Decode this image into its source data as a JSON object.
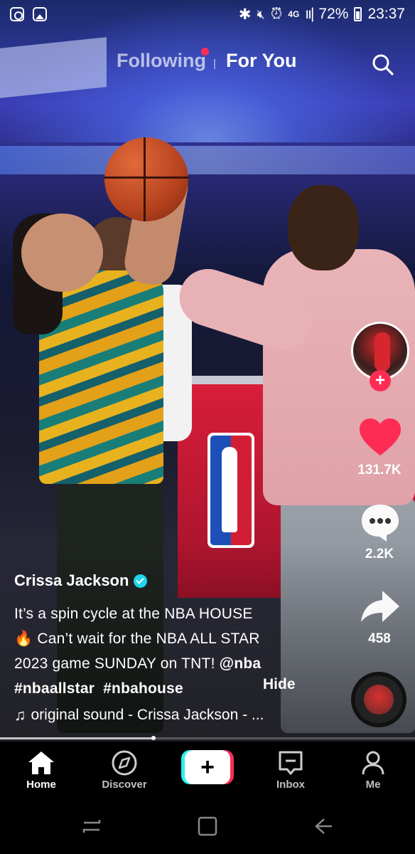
{
  "status_bar": {
    "icons_left": [
      "instagram-icon",
      "gallery-icon"
    ],
    "network": "4G",
    "battery": "72%",
    "time": "23:37"
  },
  "top_tabs": {
    "following": "Following",
    "for_you": "For You",
    "active": "For You"
  },
  "actions": {
    "likes": "131.7K",
    "comments": "2.2K",
    "shares": "458"
  },
  "post": {
    "author": "Crissa Jackson",
    "verified": true,
    "caption_line1": "It’s a spin cycle at the NBA HOUSE",
    "caption_line2_emoji": "🔥",
    "caption_line2": " Can’t wait for the NBA ALL STAR",
    "caption_line3_text": "2023 game SUNDAY on TNT! ",
    "caption_line3_mention": "@nba",
    "hashtag1": "#nbaallstar",
    "hashtag2": "#nbahouse",
    "hide": "Hide",
    "sound": "original sound - Crissa Jackson - ...",
    "progress": 0.37
  },
  "bottom_nav": {
    "home": "Home",
    "discover": "Discover",
    "inbox": "Inbox",
    "me": "Me",
    "create": "+"
  },
  "colors": {
    "tiktok_red": "#fe2c55",
    "tiktok_cyan": "#25f4ee",
    "verified": "#20d5ec"
  }
}
